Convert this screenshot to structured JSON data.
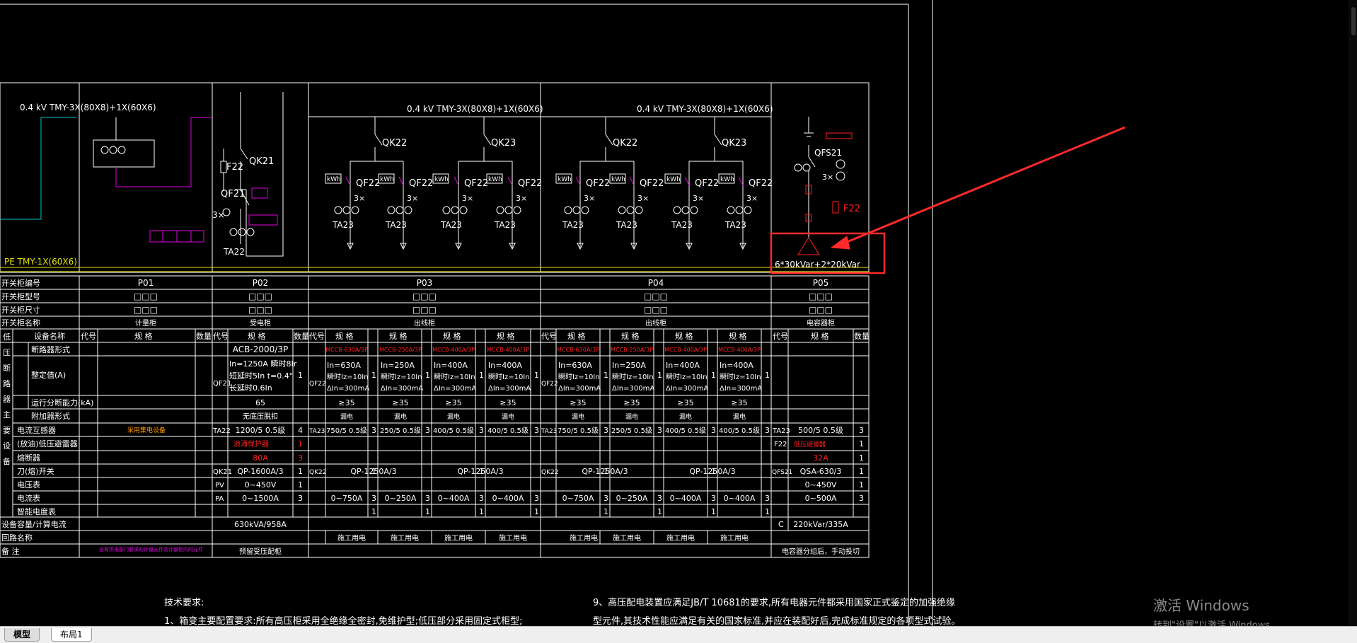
{
  "bus": {
    "left_label": "0.4 kV   TMY-3X(80X8)+1X(60X6)",
    "f03_label": "0.4 kV   TMY-3X(80X8)+1X(60X6)",
    "f04_label": "0.4 kV   TMY-3X(80X8)+1X(60X6)",
    "pe_label": "PE  TMY-1X(60X6)"
  },
  "schematic": {
    "qk21": "QK21",
    "qf21": "QF21",
    "f22": "F22",
    "ta22": "TA22",
    "three_x": "3×",
    "f03": {
      "qk_a": "QK22",
      "qk_b": "QK23",
      "qf": "QF22",
      "ta": "TA23",
      "kwh": "kWh",
      "three_x": "3×"
    },
    "f04": {
      "qk_a": "QK22",
      "qk_b": "QK23",
      "qf": "QF22",
      "ta": "TA23",
      "kwh": "kWh",
      "three_x": "3×"
    },
    "f05": {
      "qfs": "QFS21",
      "three_x": "3×",
      "f22": "F22",
      "capacitor": "6*30kVar+2*20kVar"
    }
  },
  "table": {
    "row_headers": {
      "cabinet_no": "开关柜编号",
      "cabinet_model": "开关柜型号",
      "cabinet_size": "开关柜尺寸",
      "cabinet_name": "开关柜名称",
      "equipment_name": "设备名称",
      "device_capacity": "设备容量/计算电流",
      "circuit_name": "回路名称",
      "remarks": "备 注"
    },
    "side_group": [
      "低",
      "压",
      "断",
      "路",
      "器",
      "主",
      "要",
      "设",
      "备"
    ],
    "group_rows": [
      "断路器形式",
      "整定值(A)",
      "运行分断能力(kA)",
      "附加器形式"
    ],
    "other_rows": [
      "电流互感器",
      "(放油)低压避雷器",
      "熔断器",
      "刀(熔)开关",
      "电压表",
      "电流表",
      "智能电度表"
    ],
    "col_headers": {
      "code": "代号",
      "spec": "规 格",
      "qty": "数量"
    },
    "cabinets": [
      {
        "no": "P01",
        "model": "□□□",
        "size": "□□□",
        "name": "计量柜",
        "capacity": "",
        "remark": "含有供电部门要求的计量元件及计量柜内的元件"
      },
      {
        "no": "P02",
        "model": "□□□",
        "size": "□□□",
        "name": "受电柜",
        "capacity": "630kVA/958A",
        "remark": "预留受压配柜"
      },
      {
        "no": "P03",
        "model": "□□□",
        "size": "□□□",
        "name": "出线柜"
      },
      {
        "no": "P04",
        "model": "□□□",
        "size": "□□□",
        "name": "出线柜"
      },
      {
        "no": "P05",
        "model": "□□□",
        "size": "□□□",
        "name": "电容器柜",
        "capacity_code": "C",
        "capacity": "220kVar/335A",
        "remark": "电容器分组后，手动投切"
      }
    ],
    "p01_ct_spec": "采用集电设备",
    "p02": {
      "breaker": "ACB-2000/3P",
      "setting": [
        "In=1250A 瞬时8Ir",
        "短延时5In t=0.4\"",
        "长延时0.6In"
      ],
      "capacity": "65",
      "accessory": "无底压脱扣",
      "ct": "1200/5  0.5级",
      "ct_qty": "4",
      "arrester": "浪涌保护器",
      "fuse": "80A",
      "switch": "QP-1600A/3",
      "volt": "0~450V",
      "amp": "0~1500A",
      "code_qf": "QF21",
      "code_ta": "TA22",
      "code_qk": "QK21",
      "code_pv": "PV",
      "code_pa": "PA",
      "qty_1": "1",
      "qty_3": "3"
    },
    "feeders": {
      "codes": {
        "qf": "QF22",
        "ta": "TA23",
        "qk": "QK22"
      },
      "breakers": [
        "MCCB-630A/3P",
        "MCCB-250A/3P",
        "MCCB-400A/3P",
        "MCCB-400A/3P"
      ],
      "ln": [
        "In=630A",
        "In=250A",
        "In=400A",
        "In=400A"
      ],
      "iz": "瞬时Iz=10In",
      "dln": "ΔIn=300mA",
      "capacity": "≥35",
      "accessory": "漏电",
      "cts": [
        "750/5 0.5级",
        "250/5 0.5级",
        "400/5 0.5级",
        "400/5 0.5级"
      ],
      "switch": "QP-1250A/3",
      "amps": [
        "0~750A",
        "0~250A",
        "0~400A",
        "0~400A"
      ],
      "circuit": "施工用电",
      "qty_1": "1",
      "qty_3": "3"
    },
    "p05": {
      "ct": "500/5  0.5级",
      "arrester": "低压避雷器",
      "fuse": "32A",
      "switch": "QSA-630/3",
      "volt": "0~450V",
      "amp": "0~500A",
      "code_ta": "TA23",
      "code_f": "F22",
      "code_qfs": "QFS21",
      "qty_1": "1",
      "qty_3": "3"
    }
  },
  "notes": {
    "heading": "技术要求:",
    "line1": "1、箱变主要配置要求:所有高压柜采用全绝缘全密封,免维护型;低压部分采用固定式柜型;",
    "line9a": "9、高压配电装置应满足JB/T 10681的要求,所有电器元件都采用国家正式鉴定的加强绝缘",
    "line9b": "型元件,其技术性能应满足有关的国家标准,并应在装配好后,完成标准规定的各项型式试验。"
  },
  "watermark": {
    "line1": "激活 Windows",
    "line2": "转到\"设置\"以激活 Windows。"
  },
  "tabs": {
    "model": "模型",
    "layout": "布局1"
  },
  "colors": {
    "bus": "#ffffff",
    "pe": "#e6e600",
    "cyan": "#00c8c8",
    "magenta": "#e000e0",
    "red": "#ff2020",
    "orange": "#ff9900",
    "annotation": "#ff2a2a"
  }
}
